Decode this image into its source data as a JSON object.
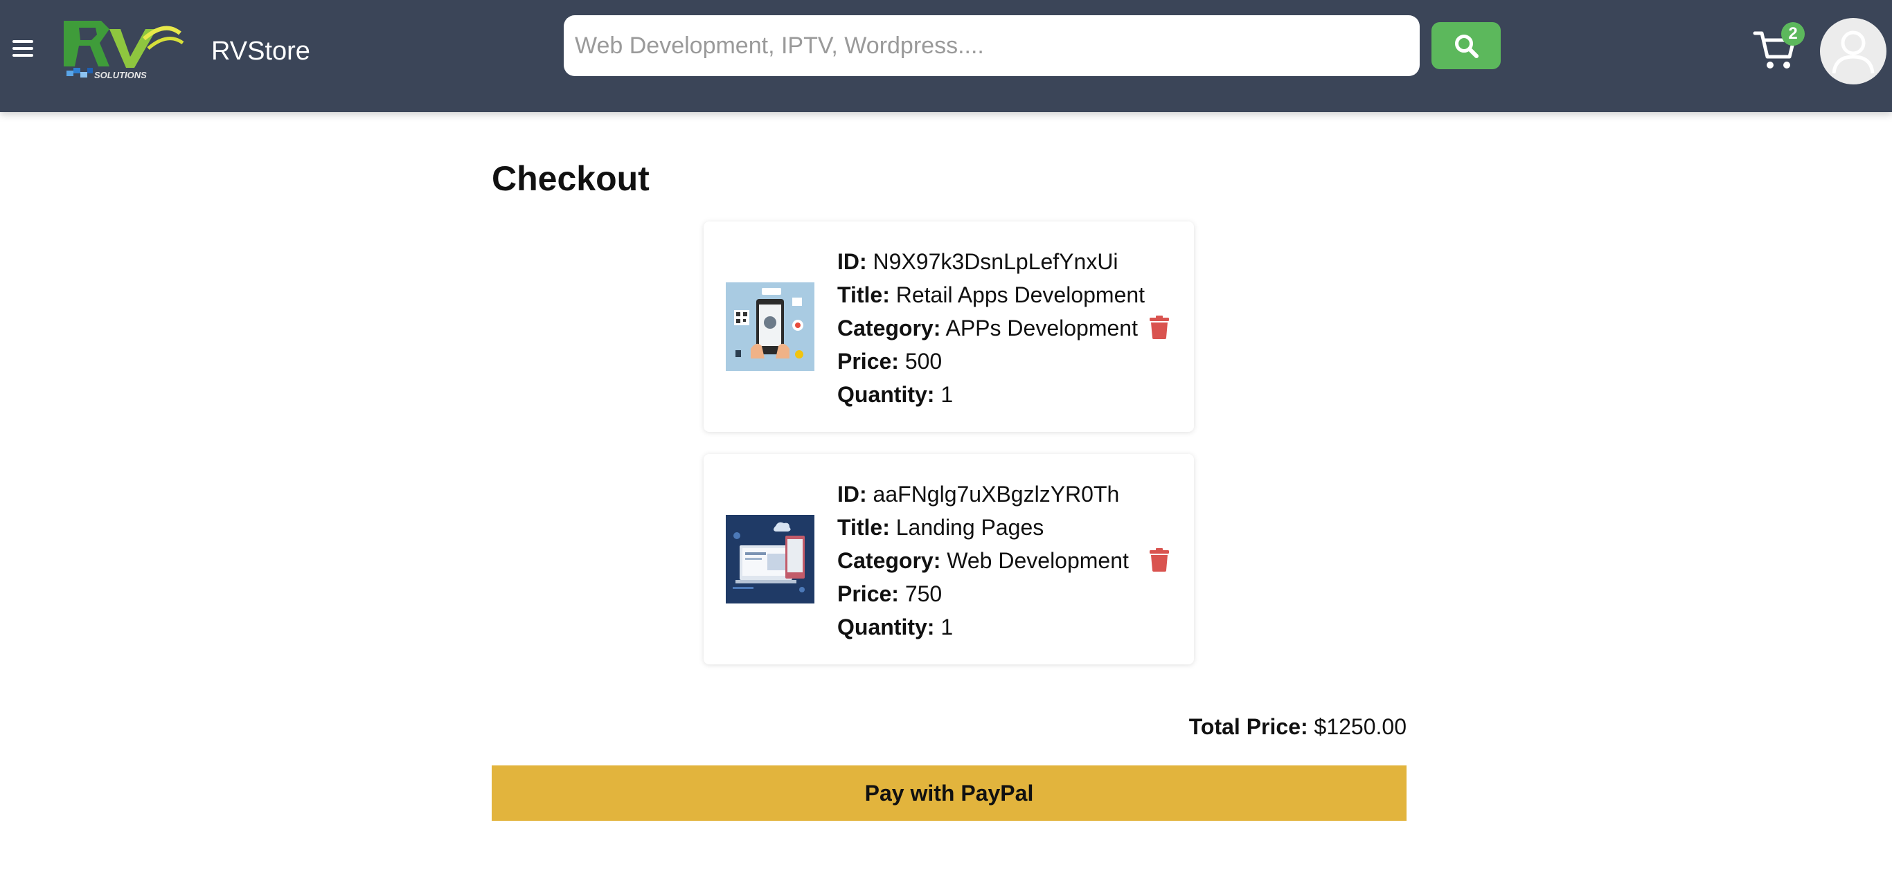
{
  "header": {
    "brand_name": "RVStore",
    "logo_text": "SOLUTIONS",
    "search": {
      "placeholder": "Web Development, IPTV, Wordpress...."
    },
    "cart_count": "2"
  },
  "page": {
    "title": "Checkout"
  },
  "items": [
    {
      "id_label": "ID:",
      "id": "N9X97k3DsnLpLefYnxUi",
      "title_label": "Title:",
      "title": "Retail Apps Development",
      "category_label": "Category:",
      "category": "APPs Development",
      "price_label": "Price:",
      "price": "500",
      "quantity_label": "Quantity:",
      "quantity": "1"
    },
    {
      "id_label": "ID:",
      "id": "aaFNglg7uXBgzlzYR0Th",
      "title_label": "Title:",
      "title": "Landing Pages",
      "category_label": "Category:",
      "category": "Web Development",
      "price_label": "Price:",
      "price": "750",
      "quantity_label": "Quantity:",
      "quantity": "1"
    }
  ],
  "summary": {
    "total_label": "Total Price:",
    "total_value": "$1250.00"
  },
  "actions": {
    "pay_label": "Pay with PayPal"
  },
  "colors": {
    "header_bg": "#3b4558",
    "accent_green": "#5cb85c",
    "pay_button": "#e2b43d",
    "delete_red": "#d9534f"
  }
}
